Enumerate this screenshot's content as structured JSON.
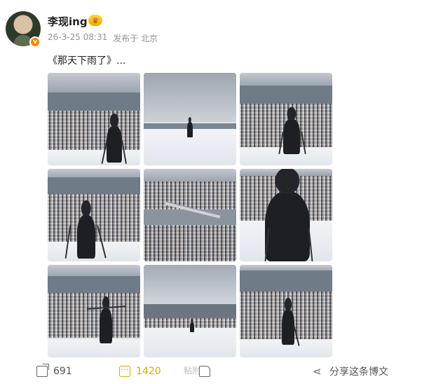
{
  "post": {
    "username": "李现ing",
    "vip_icon": "crown-icon",
    "verified_badge": "v",
    "date": "26-3-25 08:31",
    "source": "发布于 北京",
    "text": "《那天下雨了》..."
  },
  "photos": [
    {
      "scene": "town-skyline-person-hiking-poles"
    },
    {
      "scene": "snowfield-distant-person"
    },
    {
      "scene": "town-skyline-person-walking"
    },
    {
      "scene": "town-skyline-person-hooded"
    },
    {
      "scene": "aerial-town-bridge"
    },
    {
      "scene": "person-closeup-hiking-poles"
    },
    {
      "scene": "town-skyline-person-arms-open"
    },
    {
      "scene": "snowfield-tiny-person"
    },
    {
      "scene": "town-skyline-person-backpack"
    }
  ],
  "actions": {
    "share_count": "691",
    "comment_count": "1420",
    "like_watermark": "粘附",
    "share_text": "分享这条博文"
  },
  "colors": {
    "accent": "#ff8200",
    "comment": "#e0a800",
    "meta": "#939393"
  }
}
